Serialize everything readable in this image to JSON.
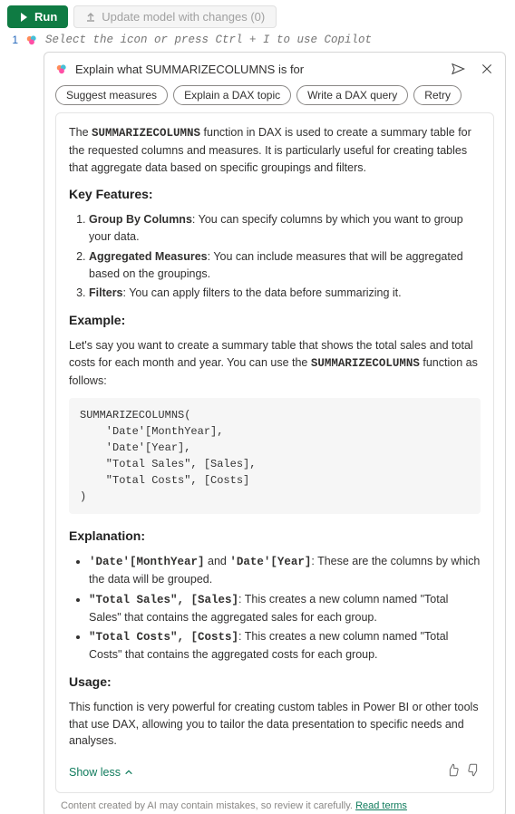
{
  "toolbar": {
    "run_label": "Run",
    "update_label": "Update model with changes (0)"
  },
  "editor": {
    "line_number": "1",
    "placeholder": "Select the icon or press Ctrl + I to use Copilot"
  },
  "panel": {
    "query": "Explain what SUMMARIZECOLUMNS is for",
    "chips": [
      "Suggest measures",
      "Explain a DAX topic",
      "Write a DAX query",
      "Retry"
    ]
  },
  "response": {
    "intro_pre": "The ",
    "intro_func": "SUMMARIZECOLUMNS",
    "intro_post": " function in DAX is used to create a summary table for the requested columns and measures. It is particularly useful for creating tables that aggregate data based on specific groupings and filters.",
    "features_heading": "Key Features:",
    "features": [
      {
        "b": "Group By Columns",
        "t": ": You can specify columns by which you want to group your data."
      },
      {
        "b": "Aggregated Measures",
        "t": ": You can include measures that will be aggregated based on the groupings."
      },
      {
        "b": "Filters",
        "t": ": You can apply filters to the data before summarizing it."
      }
    ],
    "example_heading": "Example:",
    "example_pre": "Let's say you want to create a summary table that shows the total sales and total costs for each month and year. You can use the ",
    "example_func": "SUMMARIZECOLUMNS",
    "example_post": " function as follows:",
    "codeblock": "SUMMARIZECOLUMNS(\n    'Date'[MonthYear],\n    'Date'[Year],\n    \"Total Sales\", [Sales],\n    \"Total Costs\", [Costs]\n)",
    "explanation_heading": "Explanation:",
    "explanation": [
      {
        "m1": "'Date'[MonthYear]",
        "mid": " and ",
        "m2": "'Date'[Year]",
        "t": ": These are the columns by which the data will be grouped."
      },
      {
        "m1": "\"Total Sales\", [Sales]",
        "mid": "",
        "m2": "",
        "t": ": This creates a new column named \"Total Sales\" that contains the aggregated sales for each group."
      },
      {
        "m1": "\"Total Costs\", [Costs]",
        "mid": "",
        "m2": "",
        "t": ": This creates a new column named \"Total Costs\" that contains the aggregated costs for each group."
      }
    ],
    "usage_heading": "Usage:",
    "usage_text": "This function is very powerful for creating custom tables in Power BI or other tools that use DAX, allowing you to tailor the data presentation to specific needs and analyses.",
    "show_less": "Show less"
  },
  "footer": {
    "text": "Content created by AI may contain mistakes, so review it carefully. ",
    "link": "Read terms"
  }
}
